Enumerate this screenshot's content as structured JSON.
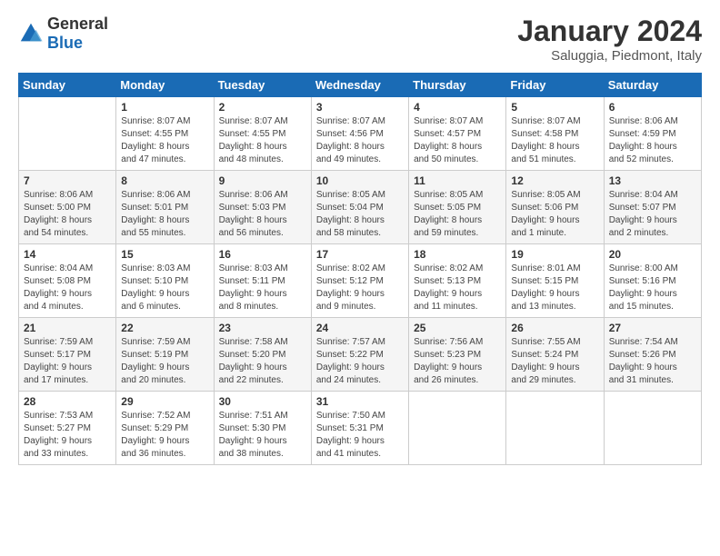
{
  "logo": {
    "general": "General",
    "blue": "Blue"
  },
  "header": {
    "title": "January 2024",
    "subtitle": "Saluggia, Piedmont, Italy"
  },
  "weekdays": [
    "Sunday",
    "Monday",
    "Tuesday",
    "Wednesday",
    "Thursday",
    "Friday",
    "Saturday"
  ],
  "weeks": [
    [
      {
        "day": "",
        "info": ""
      },
      {
        "day": "1",
        "info": "Sunrise: 8:07 AM\nSunset: 4:55 PM\nDaylight: 8 hours\nand 47 minutes."
      },
      {
        "day": "2",
        "info": "Sunrise: 8:07 AM\nSunset: 4:55 PM\nDaylight: 8 hours\nand 48 minutes."
      },
      {
        "day": "3",
        "info": "Sunrise: 8:07 AM\nSunset: 4:56 PM\nDaylight: 8 hours\nand 49 minutes."
      },
      {
        "day": "4",
        "info": "Sunrise: 8:07 AM\nSunset: 4:57 PM\nDaylight: 8 hours\nand 50 minutes."
      },
      {
        "day": "5",
        "info": "Sunrise: 8:07 AM\nSunset: 4:58 PM\nDaylight: 8 hours\nand 51 minutes."
      },
      {
        "day": "6",
        "info": "Sunrise: 8:06 AM\nSunset: 4:59 PM\nDaylight: 8 hours\nand 52 minutes."
      }
    ],
    [
      {
        "day": "7",
        "info": "Sunrise: 8:06 AM\nSunset: 5:00 PM\nDaylight: 8 hours\nand 54 minutes."
      },
      {
        "day": "8",
        "info": "Sunrise: 8:06 AM\nSunset: 5:01 PM\nDaylight: 8 hours\nand 55 minutes."
      },
      {
        "day": "9",
        "info": "Sunrise: 8:06 AM\nSunset: 5:03 PM\nDaylight: 8 hours\nand 56 minutes."
      },
      {
        "day": "10",
        "info": "Sunrise: 8:05 AM\nSunset: 5:04 PM\nDaylight: 8 hours\nand 58 minutes."
      },
      {
        "day": "11",
        "info": "Sunrise: 8:05 AM\nSunset: 5:05 PM\nDaylight: 8 hours\nand 59 minutes."
      },
      {
        "day": "12",
        "info": "Sunrise: 8:05 AM\nSunset: 5:06 PM\nDaylight: 9 hours\nand 1 minute."
      },
      {
        "day": "13",
        "info": "Sunrise: 8:04 AM\nSunset: 5:07 PM\nDaylight: 9 hours\nand 2 minutes."
      }
    ],
    [
      {
        "day": "14",
        "info": "Sunrise: 8:04 AM\nSunset: 5:08 PM\nDaylight: 9 hours\nand 4 minutes."
      },
      {
        "day": "15",
        "info": "Sunrise: 8:03 AM\nSunset: 5:10 PM\nDaylight: 9 hours\nand 6 minutes."
      },
      {
        "day": "16",
        "info": "Sunrise: 8:03 AM\nSunset: 5:11 PM\nDaylight: 9 hours\nand 8 minutes."
      },
      {
        "day": "17",
        "info": "Sunrise: 8:02 AM\nSunset: 5:12 PM\nDaylight: 9 hours\nand 9 minutes."
      },
      {
        "day": "18",
        "info": "Sunrise: 8:02 AM\nSunset: 5:13 PM\nDaylight: 9 hours\nand 11 minutes."
      },
      {
        "day": "19",
        "info": "Sunrise: 8:01 AM\nSunset: 5:15 PM\nDaylight: 9 hours\nand 13 minutes."
      },
      {
        "day": "20",
        "info": "Sunrise: 8:00 AM\nSunset: 5:16 PM\nDaylight: 9 hours\nand 15 minutes."
      }
    ],
    [
      {
        "day": "21",
        "info": "Sunrise: 7:59 AM\nSunset: 5:17 PM\nDaylight: 9 hours\nand 17 minutes."
      },
      {
        "day": "22",
        "info": "Sunrise: 7:59 AM\nSunset: 5:19 PM\nDaylight: 9 hours\nand 20 minutes."
      },
      {
        "day": "23",
        "info": "Sunrise: 7:58 AM\nSunset: 5:20 PM\nDaylight: 9 hours\nand 22 minutes."
      },
      {
        "day": "24",
        "info": "Sunrise: 7:57 AM\nSunset: 5:22 PM\nDaylight: 9 hours\nand 24 minutes."
      },
      {
        "day": "25",
        "info": "Sunrise: 7:56 AM\nSunset: 5:23 PM\nDaylight: 9 hours\nand 26 minutes."
      },
      {
        "day": "26",
        "info": "Sunrise: 7:55 AM\nSunset: 5:24 PM\nDaylight: 9 hours\nand 29 minutes."
      },
      {
        "day": "27",
        "info": "Sunrise: 7:54 AM\nSunset: 5:26 PM\nDaylight: 9 hours\nand 31 minutes."
      }
    ],
    [
      {
        "day": "28",
        "info": "Sunrise: 7:53 AM\nSunset: 5:27 PM\nDaylight: 9 hours\nand 33 minutes."
      },
      {
        "day": "29",
        "info": "Sunrise: 7:52 AM\nSunset: 5:29 PM\nDaylight: 9 hours\nand 36 minutes."
      },
      {
        "day": "30",
        "info": "Sunrise: 7:51 AM\nSunset: 5:30 PM\nDaylight: 9 hours\nand 38 minutes."
      },
      {
        "day": "31",
        "info": "Sunrise: 7:50 AM\nSunset: 5:31 PM\nDaylight: 9 hours\nand 41 minutes."
      },
      {
        "day": "",
        "info": ""
      },
      {
        "day": "",
        "info": ""
      },
      {
        "day": "",
        "info": ""
      }
    ]
  ]
}
